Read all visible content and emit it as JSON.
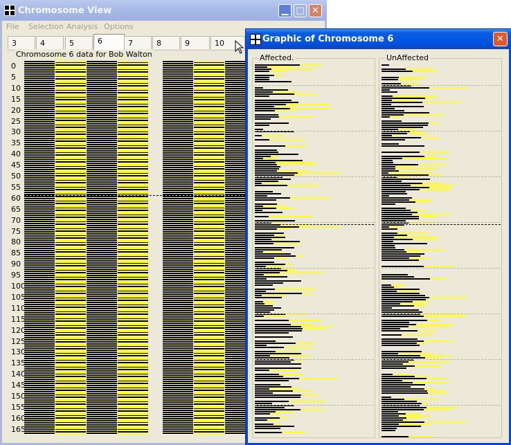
{
  "main_window": {
    "title": "Chromosome View",
    "menu": [
      "File",
      "Selection",
      "Analysis",
      "Options"
    ],
    "tabs": [
      "3",
      "4",
      "5",
      "6",
      "7",
      "8",
      "9",
      "10"
    ],
    "active_tab": "6",
    "group_label": "Chromosome 6 data for  Bob Walton",
    "row_labels": [
      "0",
      "5",
      "10",
      "15",
      "20",
      "25",
      "30",
      "35",
      "40",
      "45",
      "50",
      "55",
      "60",
      "65",
      "70",
      "75",
      "80",
      "85",
      "90",
      "95",
      "100",
      "105",
      "110",
      "115",
      "120",
      "125",
      "130",
      "135",
      "140",
      "145",
      "150",
      "155",
      "160",
      "165"
    ]
  },
  "graphic_window": {
    "title": "Graphic of Chromosome 6",
    "affected_label": "Affected.",
    "unaffected_label": "UnAffected"
  },
  "colors": {
    "yellow": "#fffb2c",
    "black": "#000000",
    "xp_blue": "#0055e5",
    "xp_inactive": "#a5b8e6"
  }
}
